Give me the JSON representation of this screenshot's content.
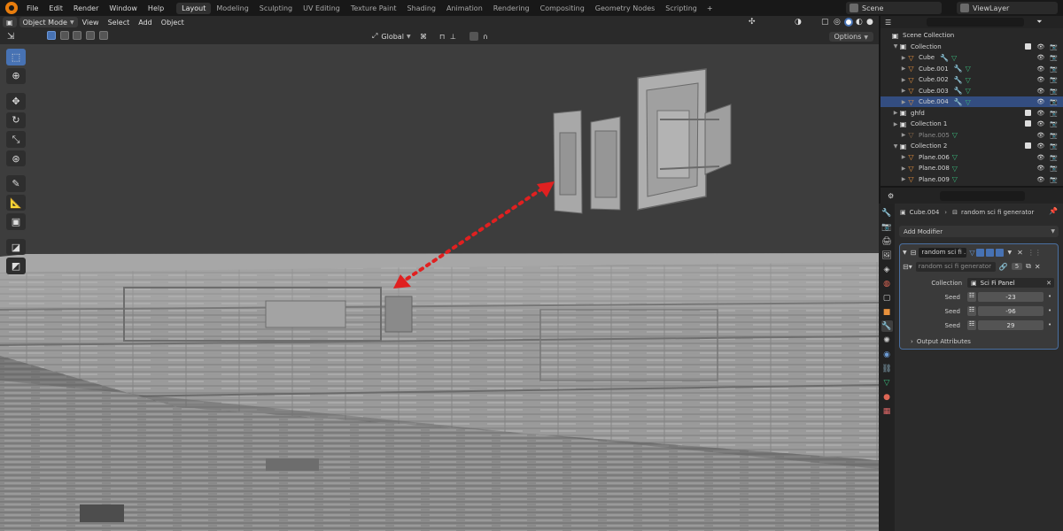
{
  "topbar": {
    "menus": [
      "File",
      "Edit",
      "Render",
      "Window",
      "Help"
    ],
    "workspaces": [
      "Layout",
      "Modeling",
      "Sculpting",
      "UV Editing",
      "Texture Paint",
      "Shading",
      "Animation",
      "Rendering",
      "Compositing",
      "Geometry Nodes",
      "Scripting"
    ],
    "active_workspace": "Layout",
    "add_workspace": "+",
    "scene": "Scene",
    "view_layer": "ViewLayer"
  },
  "header": {
    "mode": "Object Mode",
    "menus": [
      "View",
      "Select",
      "Add",
      "Object"
    ],
    "transform_orientation": "Global",
    "options": "Options"
  },
  "outliner": {
    "rows": [
      {
        "label": "Scene Collection",
        "type": "scene",
        "indent": 0
      },
      {
        "label": "Collection",
        "type": "collection",
        "indent": 1,
        "expanded": true
      },
      {
        "label": "Cube",
        "type": "mesh",
        "indent": 2,
        "modifier": true
      },
      {
        "label": "Cube.001",
        "type": "mesh",
        "indent": 2,
        "modifier": true
      },
      {
        "label": "Cube.002",
        "type": "mesh",
        "indent": 2,
        "modifier": true
      },
      {
        "label": "Cube.003",
        "type": "mesh",
        "indent": 2,
        "modifier": true
      },
      {
        "label": "Cube.004",
        "type": "mesh",
        "indent": 2,
        "modifier": true,
        "selected": true
      },
      {
        "label": "ghfd",
        "type": "collection",
        "indent": 1
      },
      {
        "label": "Collection 1",
        "type": "collection",
        "indent": 1
      },
      {
        "label": "Plane.005",
        "type": "mesh",
        "indent": 2,
        "dim": true
      },
      {
        "label": "Collection 2",
        "type": "collection",
        "indent": 1,
        "expanded": true
      },
      {
        "label": "Plane.006",
        "type": "mesh",
        "indent": 2
      },
      {
        "label": "Plane.008",
        "type": "mesh",
        "indent": 2
      },
      {
        "label": "Plane.009",
        "type": "mesh",
        "indent": 2
      }
    ]
  },
  "properties": {
    "object_name": "Cube.004",
    "modifier_breadcrumb": "random sci fi generator",
    "add_modifier": "Add Modifier",
    "modifier_name": "random sci fi ...",
    "node_group": "random sci fi generator",
    "node_users": "5",
    "collection_label": "Collection",
    "collection_value": "Sci Fi Panel",
    "seeds": [
      {
        "label": "Seed",
        "value": "-23"
      },
      {
        "label": "Seed",
        "value": "-96"
      },
      {
        "label": "Seed",
        "value": "29"
      }
    ],
    "output_attributes": "Output Attributes"
  },
  "colors": {
    "accent": "#4772b3",
    "selected_row": "#334d80",
    "arrow": "#e02020",
    "mesh_icon": "#e8913c"
  }
}
